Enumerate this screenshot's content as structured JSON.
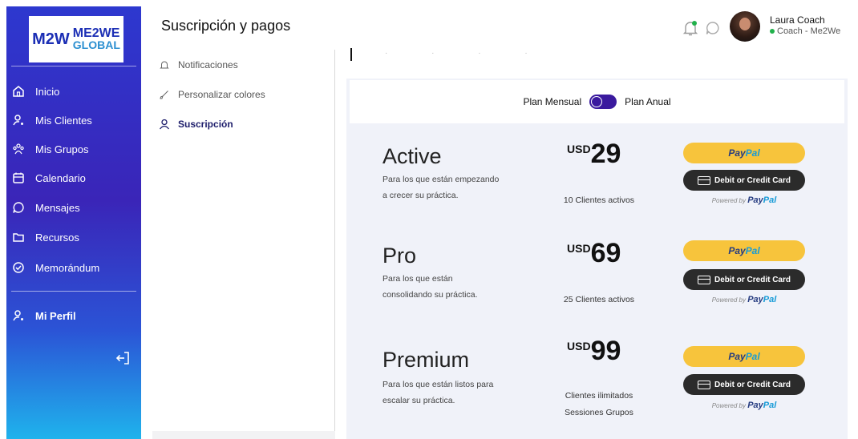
{
  "logo": {
    "mark": "M2W",
    "line1": "ME2WE",
    "line2": "GLOBAL"
  },
  "sidebar": {
    "items": [
      {
        "label": "Inicio",
        "icon": "home-icon"
      },
      {
        "label": "Mis Clientes",
        "icon": "user-icon"
      },
      {
        "label": "Mis Grupos",
        "icon": "group-icon"
      },
      {
        "label": "Calendario",
        "icon": "calendar-icon"
      },
      {
        "label": "Mensajes",
        "icon": "chat-icon"
      },
      {
        "label": "Recursos",
        "icon": "folder-icon"
      },
      {
        "label": "Memorándum",
        "icon": "check-circle-icon"
      }
    ],
    "profile": {
      "label": "Mi Perfil",
      "icon": "profile-icon"
    },
    "logout_icon": "logout-icon"
  },
  "header": {
    "title": "Suscripción y pagos",
    "user_name": "Laura Coach",
    "user_role": "Coach - Me2We",
    "status_color": "#21b14b"
  },
  "settings_menu": {
    "items": [
      {
        "label": "Notificaciones",
        "icon": "bell-icon",
        "active": false
      },
      {
        "label": "Personalizar colores",
        "icon": "brush-icon",
        "active": false
      },
      {
        "label": "Suscripción",
        "icon": "user-icon",
        "active": true
      }
    ]
  },
  "billing": {
    "monthly_label": "Plan Mensual",
    "annual_label": "Plan Anual",
    "annual_selected": true
  },
  "plans": [
    {
      "name": "Active",
      "desc_line1": "Para los que están empezando",
      "desc_line2": "a crecer su práctica.",
      "currency": "USD",
      "price": "29",
      "feature1": "10 Clientes activos",
      "feature2": ""
    },
    {
      "name": "Pro",
      "desc_line1": "Para los que están",
      "desc_line2": "consolidando su práctica.",
      "currency": "USD",
      "price": "69",
      "feature1": "25 Clientes activos",
      "feature2": ""
    },
    {
      "name": "Premium",
      "desc_line1": "Para los que están listos para",
      "desc_line2": "escalar su práctica.",
      "currency": "USD",
      "price": "99",
      "feature1": "Clientes ilimitados",
      "feature2": "Sessiones Grupos"
    }
  ],
  "paypal": {
    "brand_part1": "Pay",
    "brand_part2": "Pal",
    "card_label": "Debit or Credit Card",
    "powered_by": "Powered by"
  },
  "colors": {
    "accent": "#3a1a9e",
    "paypal_yellow": "#f7c43c",
    "card_button": "#2b2b2b"
  }
}
